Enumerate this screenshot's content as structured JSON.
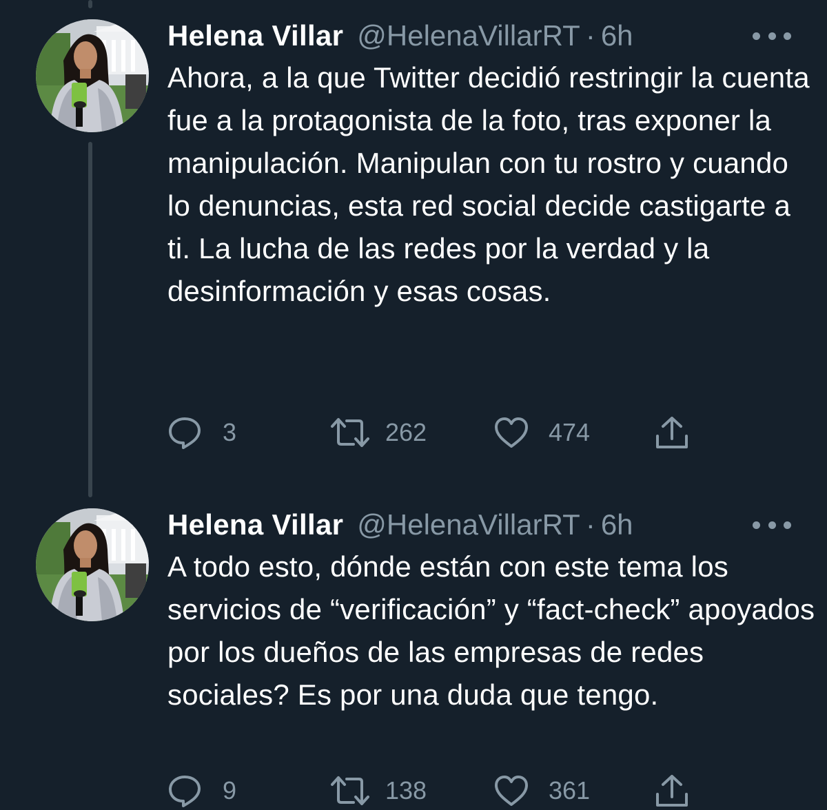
{
  "tweets": [
    {
      "display_name": "Helena Villar",
      "handle": "@HelenaVillarRT",
      "separator": "·",
      "time": "6h",
      "avatar_icon": "profile-photo",
      "text": "Ahora, a la que Twitter decidió restringir la cuenta fue a la protagonista de la foto, tras exponer la manipulación. Manipulan con tu rostro y cuando lo denuncias, esta red social decide castigarte a ti. La lucha de las redes por la verdad y la desinformación y esas cosas.",
      "replies": "3",
      "retweets": "262",
      "likes": "474"
    },
    {
      "display_name": "Helena Villar",
      "handle": "@HelenaVillarRT",
      "separator": "·",
      "time": "6h",
      "avatar_icon": "profile-photo",
      "text": "A todo esto, dónde están con este tema los servicios de “verificación” y “fact-check” apoyados por los dueños de las empresas de redes sociales? Es por una duda que tengo.",
      "replies": "9",
      "retweets": "138",
      "likes": "361"
    }
  ],
  "icons": {
    "reply": "reply-icon",
    "retweet": "retweet-icon",
    "like": "heart-icon",
    "share": "share-icon",
    "more": "more-icon"
  },
  "colors": {
    "background": "#15202b",
    "text": "#ffffff",
    "secondary": "#8899a6",
    "thread_line": "#38444d"
  }
}
